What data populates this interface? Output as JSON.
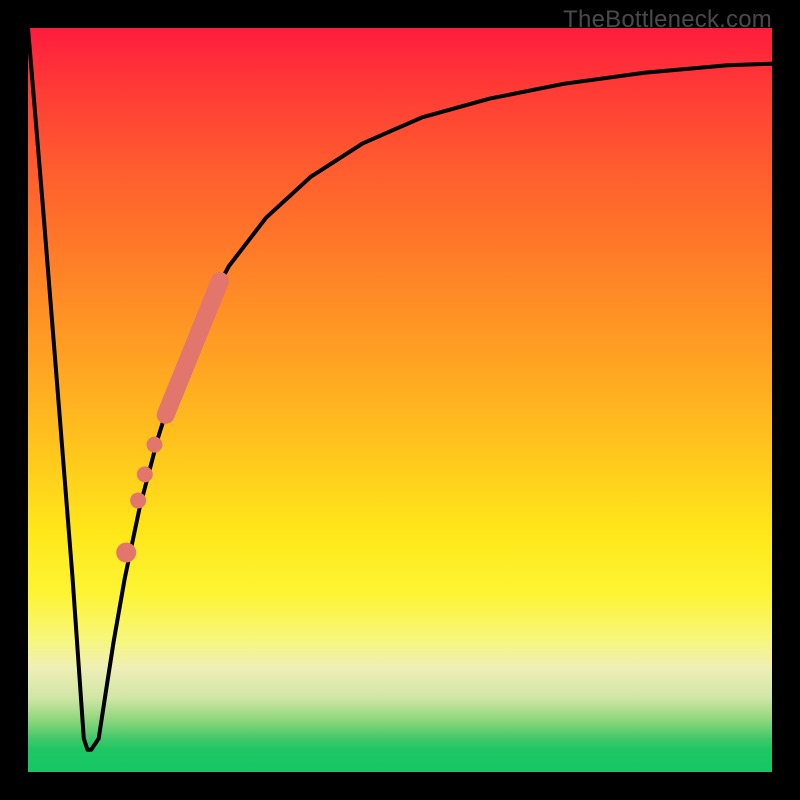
{
  "attribution": "TheBottleneck.com",
  "colors": {
    "frame": "#000000",
    "curve": "#000000",
    "markers": "#e2766c",
    "gradient_top": "#ff1c3d",
    "gradient_bottom": "#16c765"
  },
  "chart_data": {
    "type": "line",
    "title": "",
    "xlabel": "",
    "ylabel": "",
    "xlim": [
      0,
      1
    ],
    "ylim": [
      0,
      1
    ],
    "annotations": [],
    "series": [
      {
        "name": "bottleneck-curve",
        "x": [
          0.0,
          0.02,
          0.04,
          0.06,
          0.075,
          0.08,
          0.085,
          0.095,
          0.105,
          0.115,
          0.13,
          0.15,
          0.175,
          0.2,
          0.23,
          0.27,
          0.32,
          0.38,
          0.45,
          0.53,
          0.62,
          0.72,
          0.83,
          0.94,
          1.0
        ],
        "y": [
          1.0,
          0.76,
          0.51,
          0.26,
          0.045,
          0.03,
          0.03,
          0.045,
          0.11,
          0.175,
          0.26,
          0.355,
          0.45,
          0.53,
          0.605,
          0.68,
          0.745,
          0.8,
          0.845,
          0.88,
          0.905,
          0.925,
          0.94,
          0.95,
          0.952
        ]
      }
    ],
    "markers": {
      "name": "highlight-segment",
      "color": "#e2766c",
      "stroke_points": {
        "x": [
          0.185,
          0.258
        ],
        "y": [
          0.48,
          0.66
        ]
      },
      "dots": [
        {
          "x": 0.17,
          "y": 0.44,
          "r": 8
        },
        {
          "x": 0.157,
          "y": 0.4,
          "r": 8
        },
        {
          "x": 0.148,
          "y": 0.365,
          "r": 8
        },
        {
          "x": 0.132,
          "y": 0.295,
          "r": 10
        }
      ]
    }
  }
}
